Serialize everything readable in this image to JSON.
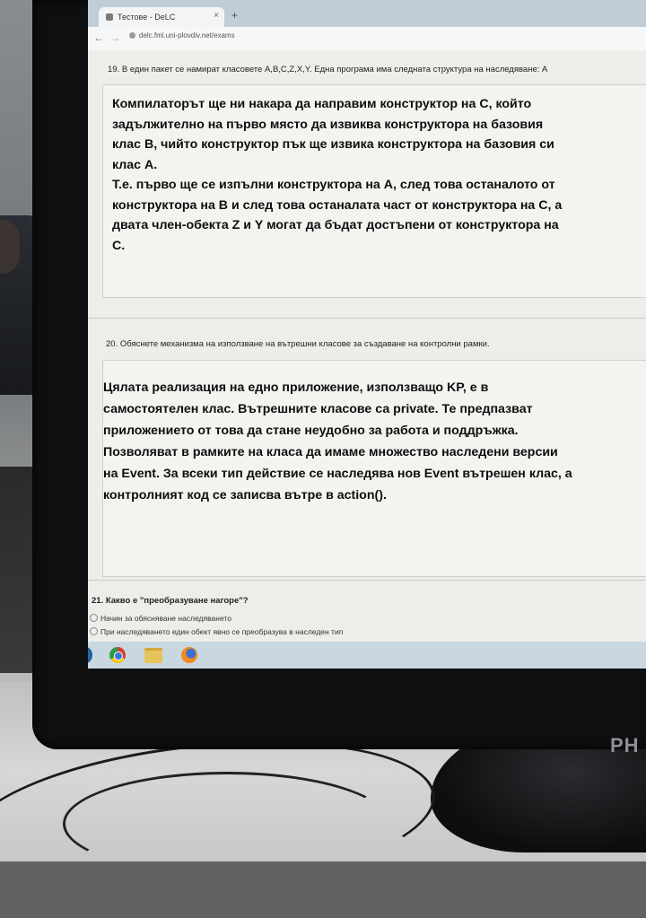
{
  "browser": {
    "tab_title": "Тестове - DeLC",
    "tab_close": "×",
    "new_tab": "+",
    "url": "delc.fmi.uni-plovdiv.net/exams"
  },
  "questions": [
    {
      "title": "19. В един пакет се намират класовете A,B,C,Z,X,Y. Една програма има следната структура на наследяване: A",
      "answer_lines": [
        "Компилаторът ще ни накара да направим конструктор на С, който",
        "задължително на първо място да извиква конструктора на базовия",
        "клас B, чийто конструктор пък ще извика конструктора на базовия си",
        "клас A.",
        "Т.е. първо ще се изпълни конструктора на A, след това останалото от",
        "конструктора на B и след това останалата част от конструктора на C, а",
        "двата член-обекта Z и Y могат да бъдат достъпени от конструктора на",
        "C."
      ]
    },
    {
      "title": "20. Обяснете механизма на използване на вътрешни класове за създаване на контролни рамки.",
      "answer_lines": [
        "Цялата реализация на едно приложение, използващо KP, е в",
        "самостоятелен клас. Вътрешните класове са private. Те предпазват",
        "приложението от това да стане неудобно за работа и поддръжка.",
        "Позволяват в рамките на класа да имаме множество наследени версии",
        "на Event. За всеки тип действие се наследява нов Event вътрешен клас, а",
        "контролният код се записва вътре в action()."
      ]
    },
    {
      "title": "21. Какво е \"преобразуване нагоре\"?",
      "options": [
        "Начин за обясняване наследяването",
        "При наследяването един обект явно се преобразува в наследен тип"
      ]
    }
  ],
  "monitor": {
    "brand": "PH"
  },
  "taskbar": {
    "icons": [
      "windows-start-icon",
      "chrome-icon",
      "folder-icon",
      "firefox-icon"
    ]
  }
}
